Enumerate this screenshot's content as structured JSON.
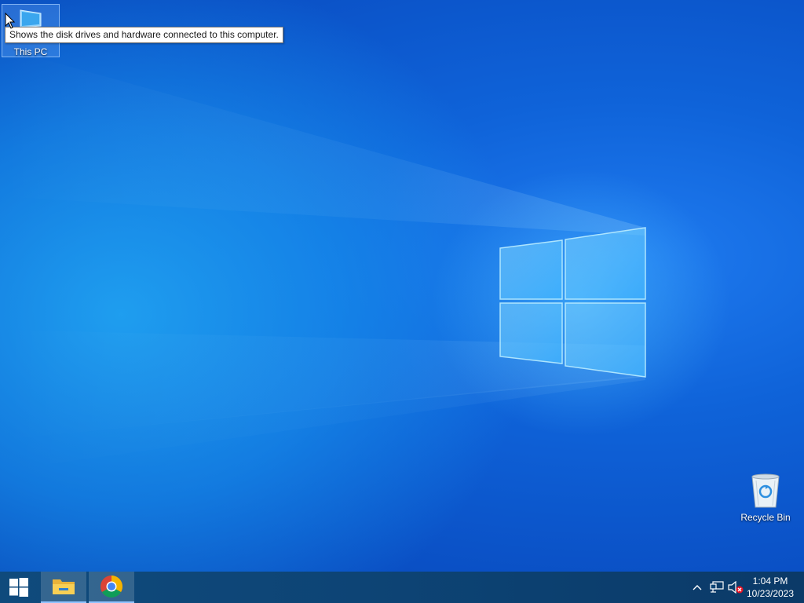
{
  "desktop": {
    "icons": [
      {
        "label": "This PC",
        "icon": "this-pc-icon",
        "selected": true
      },
      {
        "label": "Recycle Bin",
        "icon": "recycle-bin-icon",
        "selected": false
      }
    ],
    "tooltip": "Shows the disk drives and hardware connected to this computer."
  },
  "taskbar": {
    "start_icon": "windows-logo-icon",
    "pinned": [
      {
        "app": "File Explorer",
        "icon": "folder-icon",
        "active": true
      },
      {
        "app": "Google Chrome",
        "icon": "chrome-icon",
        "active": true
      }
    ],
    "tray": {
      "chevron_icon": "chevron-up-icon",
      "network_icon": "network-icon",
      "volume_icon": "volume-muted-icon",
      "time": "1:04 PM",
      "date": "10/23/2023"
    }
  },
  "colors": {
    "wallpaper_primary": "#0f63d9",
    "wallpaper_glow": "#22aaf5",
    "taskbar": "#0d4475",
    "tooltip_bg": "#ffffff",
    "tooltip_border": "#767676"
  }
}
